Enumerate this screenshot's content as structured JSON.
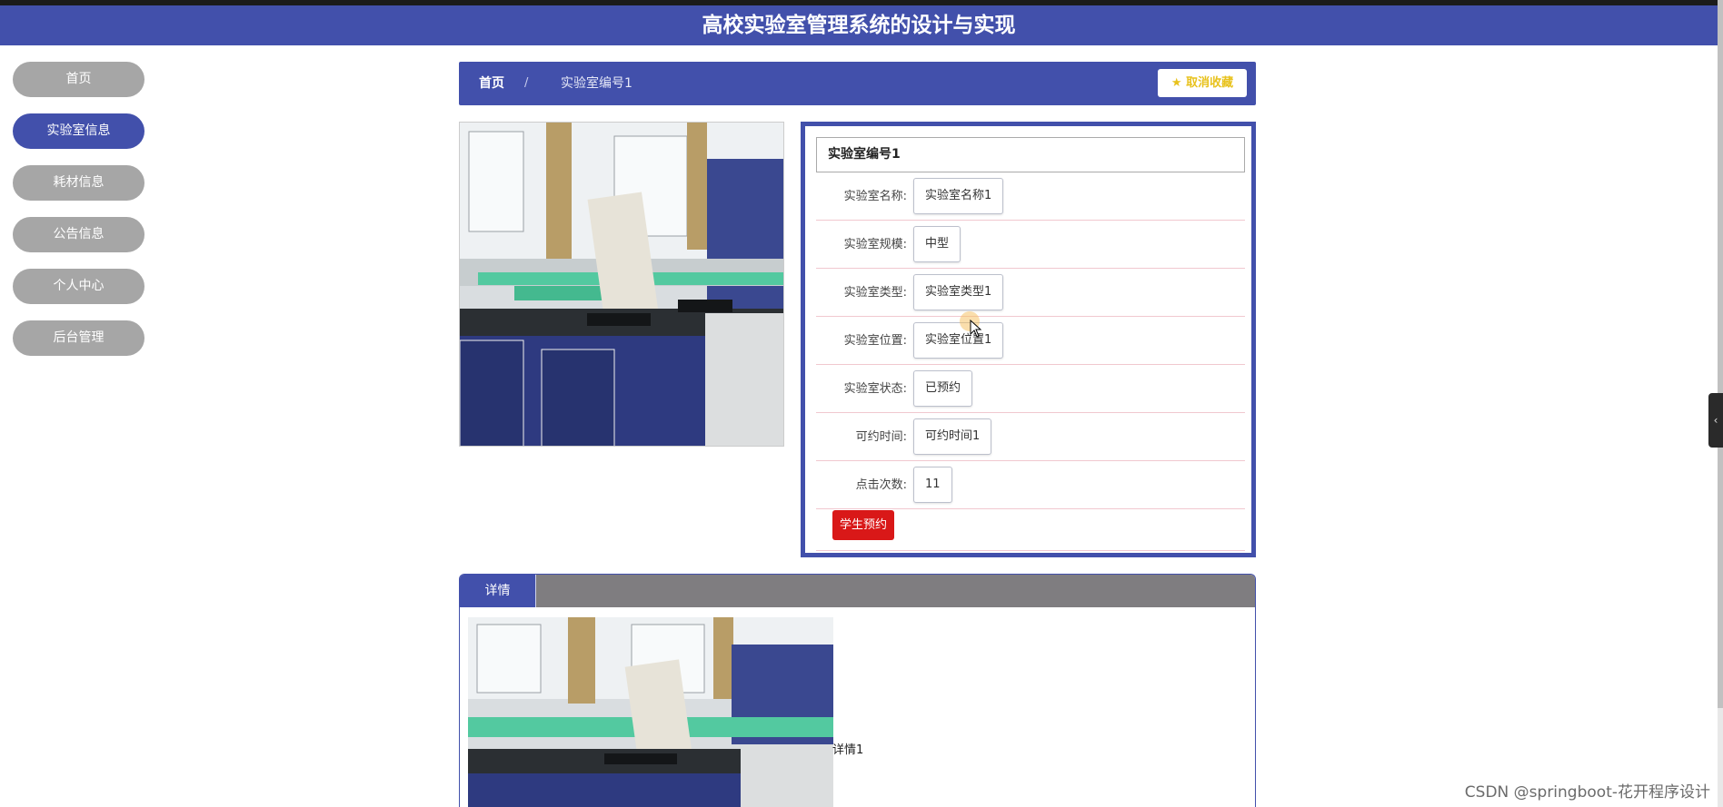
{
  "header": {
    "title": "高校实验室管理系统的设计与实现"
  },
  "sidebar": {
    "items": [
      {
        "label": "首页",
        "active": false
      },
      {
        "label": "实验室信息",
        "active": true
      },
      {
        "label": "耗材信息",
        "active": false
      },
      {
        "label": "公告信息",
        "active": false
      },
      {
        "label": "个人中心",
        "active": false
      },
      {
        "label": "后台管理",
        "active": false
      }
    ]
  },
  "breadcrumb": {
    "home": "首页",
    "separator": "/",
    "current": "实验室编号1"
  },
  "favorite": {
    "icon": "star-icon",
    "label": "取消收藏",
    "color": "#e8c21d"
  },
  "info": {
    "title": "实验室编号1",
    "rows": [
      {
        "label": "实验室名称:",
        "value": "实验室名称1"
      },
      {
        "label": "实验室规模:",
        "value": "中型"
      },
      {
        "label": "实验室类型:",
        "value": "实验室类型1"
      },
      {
        "label": "实验室位置:",
        "value": "实验室位置1"
      },
      {
        "label": "实验室状态:",
        "value": "已预约"
      },
      {
        "label": "可约时间:",
        "value": "可约时间1"
      },
      {
        "label": "点击次数:",
        "value": "11"
      }
    ],
    "reserve_button": "学生预约"
  },
  "detail": {
    "tab_label": "详情",
    "text": "详情1"
  },
  "watermark": "CSDN @springboot-花开程序设计",
  "colors": {
    "primary": "#4250ab",
    "danger": "#d91818",
    "inactive_nav": "#a6a6a6"
  }
}
